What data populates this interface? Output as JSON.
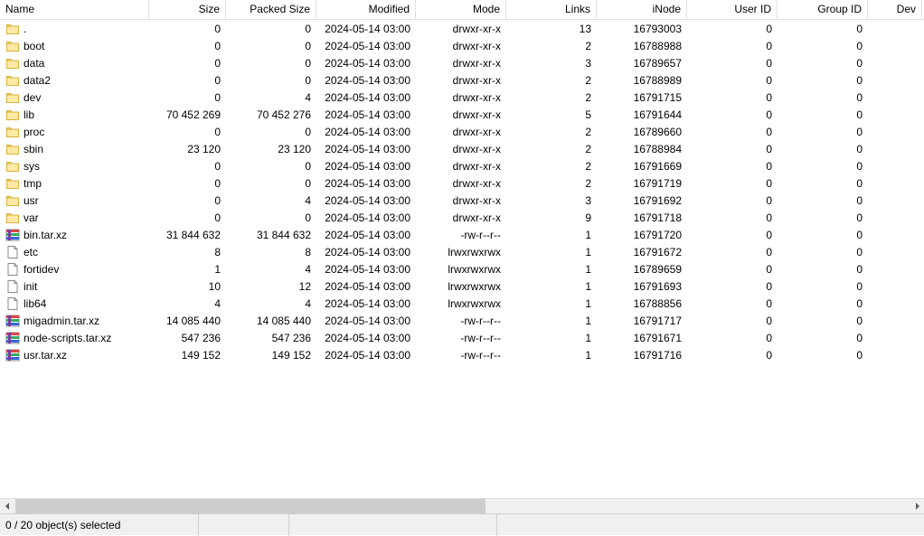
{
  "columns": [
    {
      "label": "Name",
      "align": "left"
    },
    {
      "label": "Size",
      "align": "right"
    },
    {
      "label": "Packed Size",
      "align": "right"
    },
    {
      "label": "Modified",
      "align": "right"
    },
    {
      "label": "Mode",
      "align": "right"
    },
    {
      "label": "Links",
      "align": "right"
    },
    {
      "label": "iNode",
      "align": "right"
    },
    {
      "label": "User ID",
      "align": "right"
    },
    {
      "label": "Group ID",
      "align": "right"
    },
    {
      "label": "Dev",
      "align": "right"
    }
  ],
  "rows": [
    {
      "icon": "folder",
      "name": ".",
      "size": "0",
      "packed": "0",
      "modified": "2024-05-14 03:00",
      "mode": "drwxr-xr-x",
      "links": "13",
      "inode": "16793003",
      "uid": "0",
      "gid": "0"
    },
    {
      "icon": "folder",
      "name": "boot",
      "size": "0",
      "packed": "0",
      "modified": "2024-05-14 03:00",
      "mode": "drwxr-xr-x",
      "links": "2",
      "inode": "16788988",
      "uid": "0",
      "gid": "0"
    },
    {
      "icon": "folder",
      "name": "data",
      "size": "0",
      "packed": "0",
      "modified": "2024-05-14 03:00",
      "mode": "drwxr-xr-x",
      "links": "3",
      "inode": "16789657",
      "uid": "0",
      "gid": "0"
    },
    {
      "icon": "folder",
      "name": "data2",
      "size": "0",
      "packed": "0",
      "modified": "2024-05-14 03:00",
      "mode": "drwxr-xr-x",
      "links": "2",
      "inode": "16788989",
      "uid": "0",
      "gid": "0"
    },
    {
      "icon": "folder",
      "name": "dev",
      "size": "0",
      "packed": "4",
      "modified": "2024-05-14 03:00",
      "mode": "drwxr-xr-x",
      "links": "2",
      "inode": "16791715",
      "uid": "0",
      "gid": "0"
    },
    {
      "icon": "folder",
      "name": "lib",
      "size": "70 452 269",
      "packed": "70 452 276",
      "modified": "2024-05-14 03:00",
      "mode": "drwxr-xr-x",
      "links": "5",
      "inode": "16791644",
      "uid": "0",
      "gid": "0"
    },
    {
      "icon": "folder",
      "name": "proc",
      "size": "0",
      "packed": "0",
      "modified": "2024-05-14 03:00",
      "mode": "drwxr-xr-x",
      "links": "2",
      "inode": "16789660",
      "uid": "0",
      "gid": "0"
    },
    {
      "icon": "folder",
      "name": "sbin",
      "size": "23 120",
      "packed": "23 120",
      "modified": "2024-05-14 03:00",
      "mode": "drwxr-xr-x",
      "links": "2",
      "inode": "16788984",
      "uid": "0",
      "gid": "0"
    },
    {
      "icon": "folder",
      "name": "sys",
      "size": "0",
      "packed": "0",
      "modified": "2024-05-14 03:00",
      "mode": "drwxr-xr-x",
      "links": "2",
      "inode": "16791669",
      "uid": "0",
      "gid": "0"
    },
    {
      "icon": "folder",
      "name": "tmp",
      "size": "0",
      "packed": "0",
      "modified": "2024-05-14 03:00",
      "mode": "drwxr-xr-x",
      "links": "2",
      "inode": "16791719",
      "uid": "0",
      "gid": "0"
    },
    {
      "icon": "folder",
      "name": "usr",
      "size": "0",
      "packed": "4",
      "modified": "2024-05-14 03:00",
      "mode": "drwxr-xr-x",
      "links": "3",
      "inode": "16791692",
      "uid": "0",
      "gid": "0"
    },
    {
      "icon": "folder",
      "name": "var",
      "size": "0",
      "packed": "0",
      "modified": "2024-05-14 03:00",
      "mode": "drwxr-xr-x",
      "links": "9",
      "inode": "16791718",
      "uid": "0",
      "gid": "0"
    },
    {
      "icon": "archive",
      "name": "bin.tar.xz",
      "size": "31 844 632",
      "packed": "31 844 632",
      "modified": "2024-05-14 03:00",
      "mode": "-rw-r--r--",
      "links": "1",
      "inode": "16791720",
      "uid": "0",
      "gid": "0"
    },
    {
      "icon": "file",
      "name": "etc",
      "size": "8",
      "packed": "8",
      "modified": "2024-05-14 03:00",
      "mode": "lrwxrwxrwx",
      "links": "1",
      "inode": "16791672",
      "uid": "0",
      "gid": "0"
    },
    {
      "icon": "file",
      "name": "fortidev",
      "size": "1",
      "packed": "4",
      "modified": "2024-05-14 03:00",
      "mode": "lrwxrwxrwx",
      "links": "1",
      "inode": "16789659",
      "uid": "0",
      "gid": "0"
    },
    {
      "icon": "file",
      "name": "init",
      "size": "10",
      "packed": "12",
      "modified": "2024-05-14 03:00",
      "mode": "lrwxrwxrwx",
      "links": "1",
      "inode": "16791693",
      "uid": "0",
      "gid": "0"
    },
    {
      "icon": "file",
      "name": "lib64",
      "size": "4",
      "packed": "4",
      "modified": "2024-05-14 03:00",
      "mode": "lrwxrwxrwx",
      "links": "1",
      "inode": "16788856",
      "uid": "0",
      "gid": "0"
    },
    {
      "icon": "archive",
      "name": "migadmin.tar.xz",
      "size": "14 085 440",
      "packed": "14 085 440",
      "modified": "2024-05-14 03:00",
      "mode": "-rw-r--r--",
      "links": "1",
      "inode": "16791717",
      "uid": "0",
      "gid": "0"
    },
    {
      "icon": "archive",
      "name": "node-scripts.tar.xz",
      "size": "547 236",
      "packed": "547 236",
      "modified": "2024-05-14 03:00",
      "mode": "-rw-r--r--",
      "links": "1",
      "inode": "16791671",
      "uid": "0",
      "gid": "0"
    },
    {
      "icon": "archive",
      "name": "usr.tar.xz",
      "size": "149 152",
      "packed": "149 152",
      "modified": "2024-05-14 03:00",
      "mode": "-rw-r--r--",
      "links": "1",
      "inode": "16791716",
      "uid": "0",
      "gid": "0"
    }
  ],
  "statusbar": {
    "selection": "0 / 20 object(s) selected"
  },
  "icons": {
    "folder": "folder-icon",
    "file": "file-icon",
    "archive": "archive-icon"
  }
}
